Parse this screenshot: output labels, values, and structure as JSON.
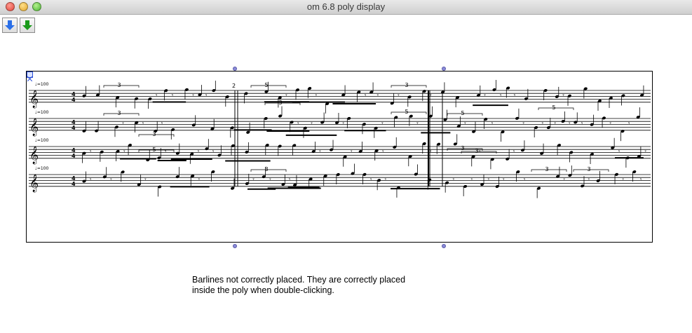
{
  "window": {
    "title": "om 6.8 poly display"
  },
  "toolbar": {
    "up_icon": "blue-down-arrow-icon",
    "down_icon": "green-down-arrow-icon"
  },
  "score": {
    "tempo_marking": "=100",
    "measure_number": "2",
    "tuplet_labels": [
      "3",
      "3",
      "3",
      "3",
      "5",
      "3",
      "5",
      "5",
      "3",
      "5",
      "3",
      "3",
      "3",
      "5",
      "3"
    ],
    "staff_count": 4
  },
  "caption": {
    "line1": "Barlines not correctly placed. They are correctly placed",
    "line2": "inside the poly when double-clicking."
  },
  "colors": {
    "handle": "#8a8ad8",
    "selection": "#2b4fd8"
  }
}
